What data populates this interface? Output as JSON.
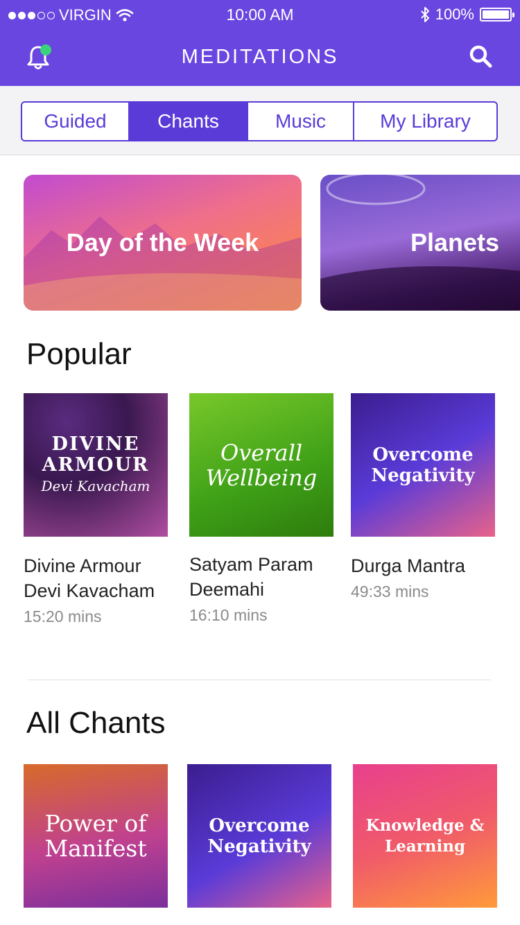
{
  "status_bar": {
    "carrier": "VIRGIN",
    "time": "10:00 AM",
    "battery": "100%"
  },
  "header": {
    "title": "MEDITATIONS"
  },
  "tabs": [
    {
      "label": "Guided",
      "active": false
    },
    {
      "label": "Chants",
      "active": true
    },
    {
      "label": "Music",
      "active": false
    },
    {
      "label": "My Library",
      "active": false
    }
  ],
  "banners": [
    {
      "label": "Day of the Week"
    },
    {
      "label": "Planets"
    }
  ],
  "popular": {
    "title": "Popular",
    "items": [
      {
        "art_line1": "DIVINE",
        "art_line2": "ARMOUR",
        "art_line3": "Devi Kavacham",
        "title_line1": "Divine Armour",
        "title_line2": "Devi Kavacham",
        "duration": "15:20 mins"
      },
      {
        "art_line1": "Overall",
        "art_line2": "Wellbeing",
        "title_line1": "Satyam Param",
        "title_line2": "Deemahi",
        "duration": "16:10 mins"
      },
      {
        "art_line1": "Overcome",
        "art_line2": "Negativity",
        "title_line1": "Durga Mantra",
        "duration": "49:33 mins"
      }
    ]
  },
  "all_chants": {
    "title": "All Chants",
    "items": [
      {
        "art_line1": "Power of",
        "art_line2": "Manifest"
      },
      {
        "art_line1": "Overcome",
        "art_line2": "Negativity"
      },
      {
        "art_line1": "Knowledge &",
        "art_line2": "Learning"
      }
    ]
  },
  "colors": {
    "brand": "#6a46e0",
    "tab_accent": "#5a3bd8",
    "notification_dot": "#3ad37c"
  },
  "icons": {
    "notifications": "bell-icon",
    "search": "search-icon",
    "wifi": "wifi-icon",
    "bluetooth": "bluetooth-icon",
    "battery": "battery-icon"
  }
}
